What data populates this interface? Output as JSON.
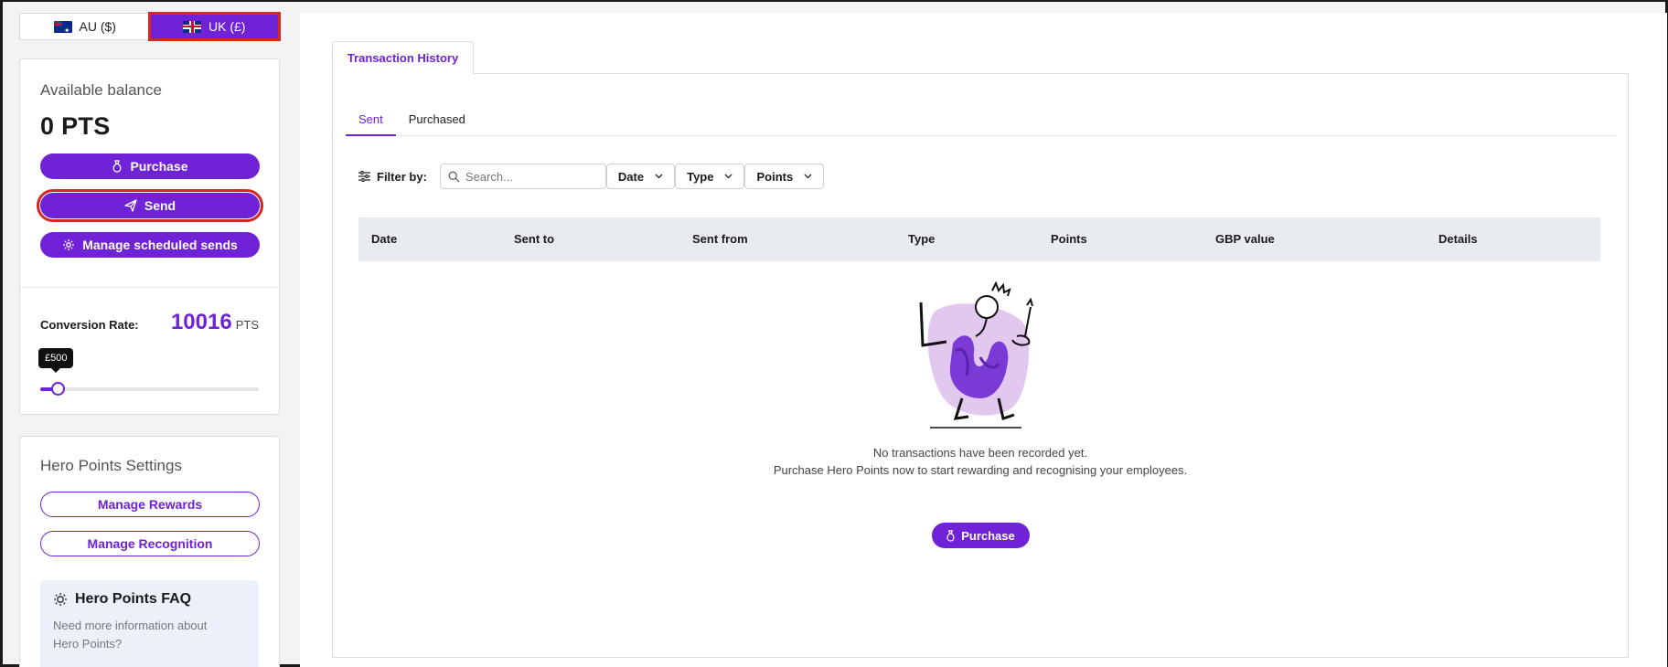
{
  "region": {
    "options": [
      {
        "label": "AU ($)"
      },
      {
        "label": "UK (£)"
      }
    ],
    "selected": "UK (£)"
  },
  "balance": {
    "label": "Available balance",
    "value": "0 PTS",
    "purchase_label": "Purchase",
    "send_label": "Send",
    "scheduled_label": "Manage scheduled sends"
  },
  "conversion": {
    "label": "Conversion Rate:",
    "value": "10016",
    "unit": "PTS",
    "slider_value": "£500",
    "slider_fraction": 0.08
  },
  "settings": {
    "title": "Hero Points Settings",
    "rewards_label": "Manage Rewards",
    "recognition_label": "Manage Recognition",
    "faq_title": "Hero Points FAQ",
    "faq_text": "Need more information about Hero Points?"
  },
  "main": {
    "tab_label": "Transaction History",
    "subtabs": [
      "Sent",
      "Purchased"
    ],
    "filter_label": "Filter by:",
    "search_placeholder": "Search...",
    "filters": [
      "Date",
      "Type",
      "Points"
    ],
    "columns": [
      "Date",
      "Sent to",
      "Sent from",
      "Type",
      "Points",
      "GBP value",
      "Details"
    ],
    "empty_line1": "No transactions have been recorded yet.",
    "empty_line2": "Purchase Hero Points now to start rewarding and recognising your employees.",
    "purchase_label": "Purchase"
  },
  "colors": {
    "accent": "#6f22d6",
    "highlight": "#d3291f"
  }
}
